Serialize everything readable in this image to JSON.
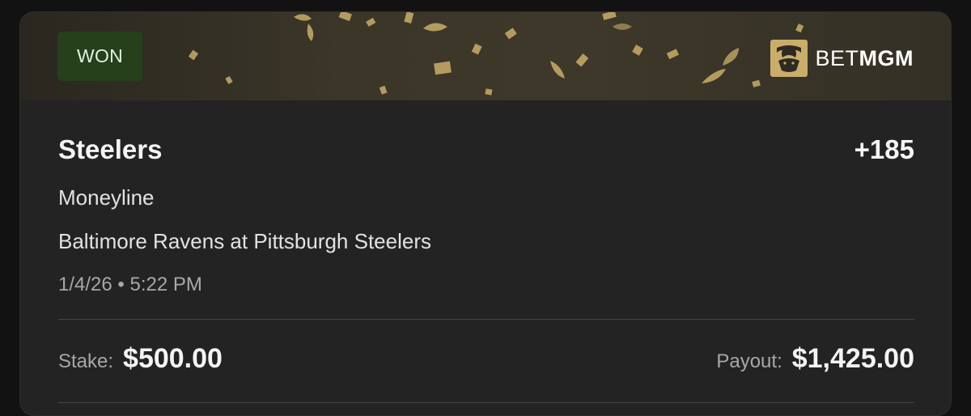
{
  "status": {
    "label": "WON",
    "color": "#25401b"
  },
  "brand": {
    "prefix": "BET",
    "suffix": "MGM",
    "logo_icon": "lion-logo-icon",
    "accent": "#c9ad6a"
  },
  "bet": {
    "selection": "Steelers",
    "odds": "+185",
    "market": "Moneyline",
    "event": "Baltimore Ravens at Pittsburgh Steelers",
    "datetime": "1/4/26 • 5:22 PM"
  },
  "totals": {
    "stake_label": "Stake:",
    "stake_value": "$500.00",
    "payout_label": "Payout:",
    "payout_value": "$1,425.00"
  }
}
